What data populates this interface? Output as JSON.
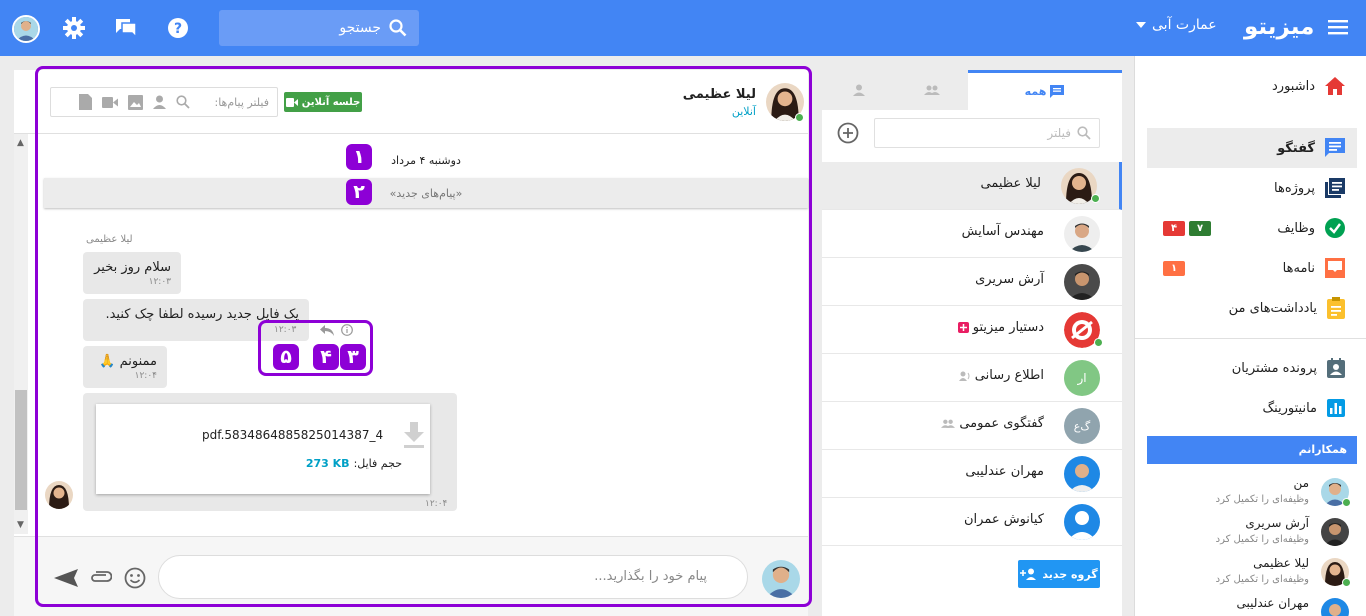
{
  "header": {
    "brand": "میزیتو",
    "org": "عمارت آبی",
    "search_placeholder": "جستجو",
    "icons": [
      "menu-icon",
      "search-icon",
      "help-icon",
      "chat-icon",
      "gear-icon"
    ]
  },
  "sidebar": {
    "items": [
      {
        "label": "داشبورد",
        "icon": "home-icon",
        "color": "#e53935"
      },
      {
        "label": "گفتگو",
        "icon": "chat-icon",
        "color": "#4285f4"
      },
      {
        "label": "پروژه‌ها",
        "icon": "projects-icon",
        "color": "#1a3a66"
      },
      {
        "label": "وظایف",
        "icon": "tasks-icon",
        "color": "#00a152",
        "badges": [
          {
            "text": "۷",
            "color": "#2e7d32"
          },
          {
            "text": "۴",
            "color": "#e53935"
          }
        ]
      },
      {
        "label": "نامه‌ها",
        "icon": "letters-icon",
        "color": "#ff7043",
        "badges": [
          {
            "text": "۱",
            "color": "#ff7043"
          }
        ]
      },
      {
        "label": "یادداشت‌های من",
        "icon": "notes-icon",
        "color": "#fbc02d"
      },
      {
        "label": "پرونده مشتریان",
        "icon": "customers-icon",
        "color": "#546e7a"
      },
      {
        "label": "مانیتورینگ",
        "icon": "monitoring-icon",
        "color": "#039be5"
      }
    ],
    "colleagues_title": "همکارانم",
    "colleagues": [
      {
        "name": "من",
        "status": "وظیفه‌ای را تکمیل کرد"
      },
      {
        "name": "آرش سریری",
        "status": "وظیفه‌ای را تکمیل کرد"
      },
      {
        "name": "لیلا عظیمی",
        "status": "وظیفه‌ای را تکمیل کرد"
      },
      {
        "name": "مهران عندلیبی",
        "status": ""
      }
    ]
  },
  "conversations": {
    "tab_all": "همه",
    "filter_placeholder": "فیلتر",
    "items": [
      {
        "name": "لیلا عظیمی",
        "selected": true
      },
      {
        "name": "مهندس آسایش"
      },
      {
        "name": "آرش سریری"
      },
      {
        "name": "دستیار میزیتو"
      },
      {
        "name": "اطلاع رسانی",
        "initials": "ار"
      },
      {
        "name": "گفتگوی عمومی",
        "initials": "گ‌ع"
      },
      {
        "name": "مهران عندلیبی"
      },
      {
        "name": "کیانوش عمران"
      }
    ],
    "new_group": "گروه جدید"
  },
  "chat": {
    "contact_name": "لیلا عظیمی",
    "contact_status": "آنلاین",
    "online_meeting": "جلسه آنلاین",
    "message_filter_placeholder": "فیلتر پیام‌ها:",
    "date_separator": "دوشنبه ۴ مرداد",
    "new_messages": "«پیام‌های جدید»",
    "sender": "لیلا عظیمی",
    "messages": [
      {
        "text": "سلام روز بخیر",
        "time": "۱۲:۰۳"
      },
      {
        "text": "یک فایل جدید رسیده لطفا چک کنید.",
        "time": "۱۲:۰۳"
      },
      {
        "text": "ممنونم 🙏",
        "time": "۱۲:۰۴"
      }
    ],
    "file": {
      "name": "pdf.5834864885825014387_4",
      "size_label": "حجم فایل:",
      "size": "273 KB",
      "time": "۱۲:۰۴"
    },
    "composer_placeholder": "پیام خود را بگذارید..."
  },
  "annotations": [
    "۱",
    "۲",
    "۳",
    "۴",
    "۵"
  ]
}
